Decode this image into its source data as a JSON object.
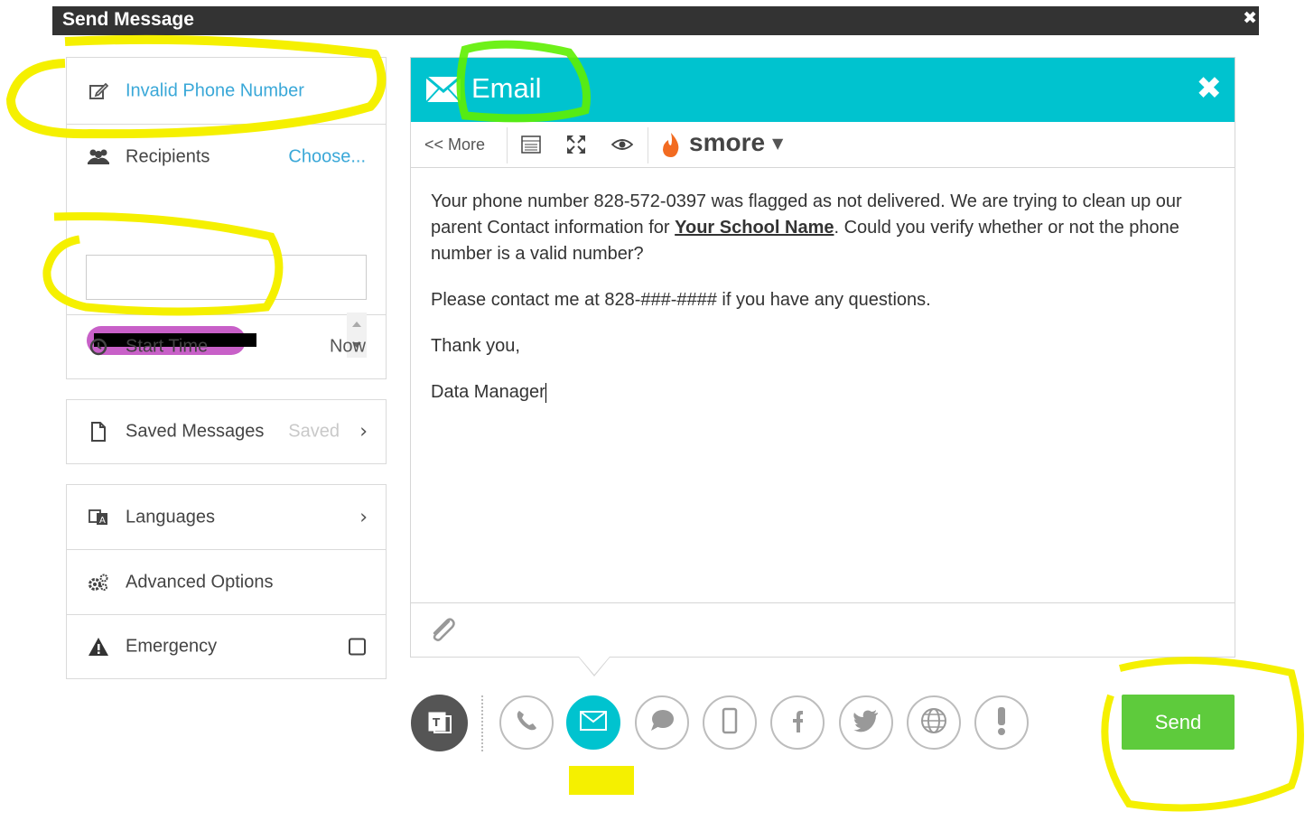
{
  "window": {
    "title": "Send Message",
    "close_glyph": "✖"
  },
  "left_panel": {
    "subject": {
      "label": "Invalid Phone Number",
      "icon": "edit-icon"
    },
    "recipients": {
      "label": "Recipients",
      "action": "Choose...",
      "icon": "users-icon"
    },
    "start_time": {
      "label": "Start Time",
      "value": "Now",
      "icon": "clock-icon"
    },
    "saved_messages": {
      "label": "Saved Messages",
      "value": "Saved",
      "icon": "file-icon"
    },
    "languages": {
      "label": "Languages",
      "icon": "translate-icon"
    },
    "advanced": {
      "label": "Advanced Options",
      "icon": "cogs-icon"
    },
    "emergency": {
      "label": "Emergency",
      "icon": "warning-icon"
    }
  },
  "email": {
    "title": "Email",
    "toolbar": {
      "more": "<< More",
      "brand": "smore"
    },
    "body": {
      "p1_before": "Your  phone number 828-572-0397 was flagged as not delivered.  We are trying to clean up our parent Contact information for ",
      "p1_school": "Your School Name",
      "p1_after": ".  Could you verify whether or not the phone number is a valid number?",
      "p2": "Please contact me at 828-###-#### if you have any questions.",
      "p3": "Thank you,",
      "p4": "Data Manager"
    }
  },
  "channels": [
    "template-icon",
    "phone-icon",
    "email-icon",
    "sms-icon",
    "mobile-icon",
    "facebook-icon",
    "twitter-icon",
    "web-icon",
    "alert-icon"
  ],
  "send_label": "Send",
  "colors": {
    "accent": "#00c3cf",
    "send": "#5ecb3c",
    "highlight": "#f5f000",
    "link": "#3aa8d8"
  }
}
